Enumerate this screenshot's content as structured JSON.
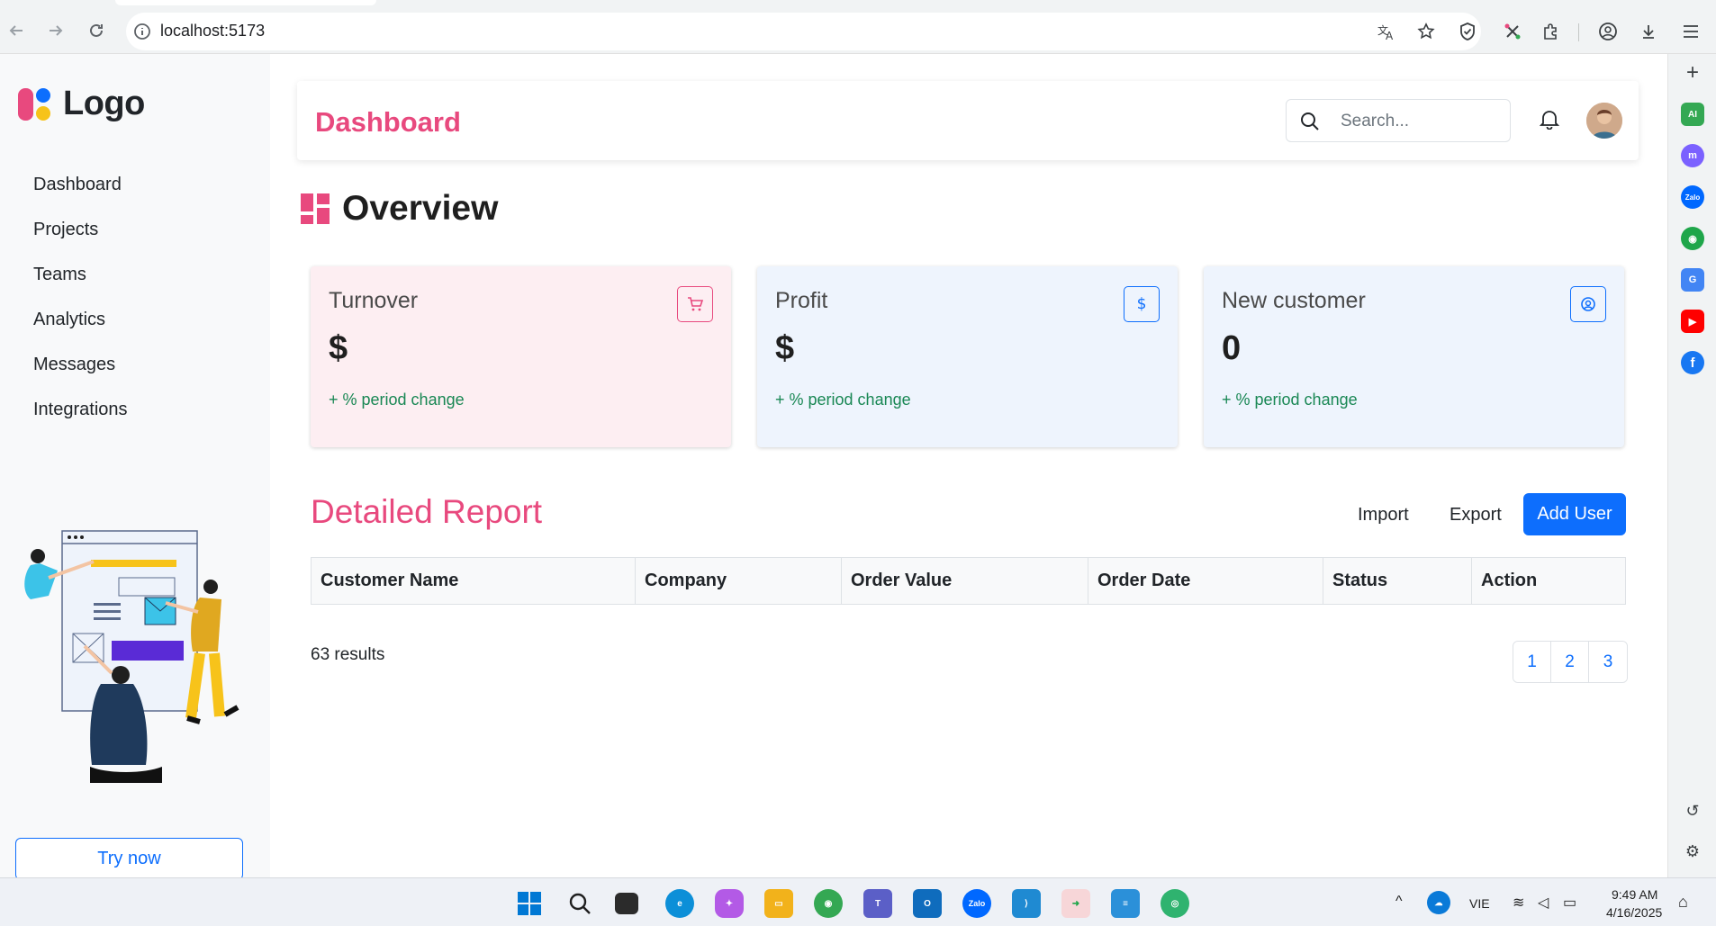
{
  "browser": {
    "url": "localhost:5173"
  },
  "sidebar": {
    "logo_text": "Logo",
    "items": [
      {
        "label": "Dashboard"
      },
      {
        "label": "Projects"
      },
      {
        "label": "Teams"
      },
      {
        "label": "Analytics"
      },
      {
        "label": "Messages"
      },
      {
        "label": "Integrations"
      }
    ],
    "try_now_label": "Try now"
  },
  "header": {
    "title": "Dashboard",
    "search_placeholder": "Search..."
  },
  "overview": {
    "title": "Overview",
    "cards": [
      {
        "title": "Turnover",
        "value": "$",
        "change": "+ % period change",
        "icon": "cart-icon",
        "bg": "#fdeef2",
        "accent": "#e8497e"
      },
      {
        "title": "Profit",
        "value": "$",
        "change": "+ % period change",
        "icon": "dollar-icon",
        "bg": "#eef4fd",
        "accent": "#0d6efd"
      },
      {
        "title": "New customer",
        "value": "0",
        "change": "+ % period change",
        "icon": "user-circle-icon",
        "bg": "#eef4fd",
        "accent": "#0d6efd"
      }
    ]
  },
  "report": {
    "title": "Detailed Report",
    "import_label": "Import",
    "export_label": "Export",
    "add_user_label": "Add User",
    "columns": [
      "Customer Name",
      "Company",
      "Order Value",
      "Order Date",
      "Status",
      "Action"
    ],
    "results_text": "63 results",
    "pages": [
      "1",
      "2",
      "3"
    ]
  },
  "taskbar": {
    "language": "VIE",
    "time": "9:49 AM",
    "date": "4/16/2025"
  },
  "colors": {
    "brand_pink": "#e8497e",
    "primary_blue": "#0d6efd",
    "success_green": "#198754"
  }
}
